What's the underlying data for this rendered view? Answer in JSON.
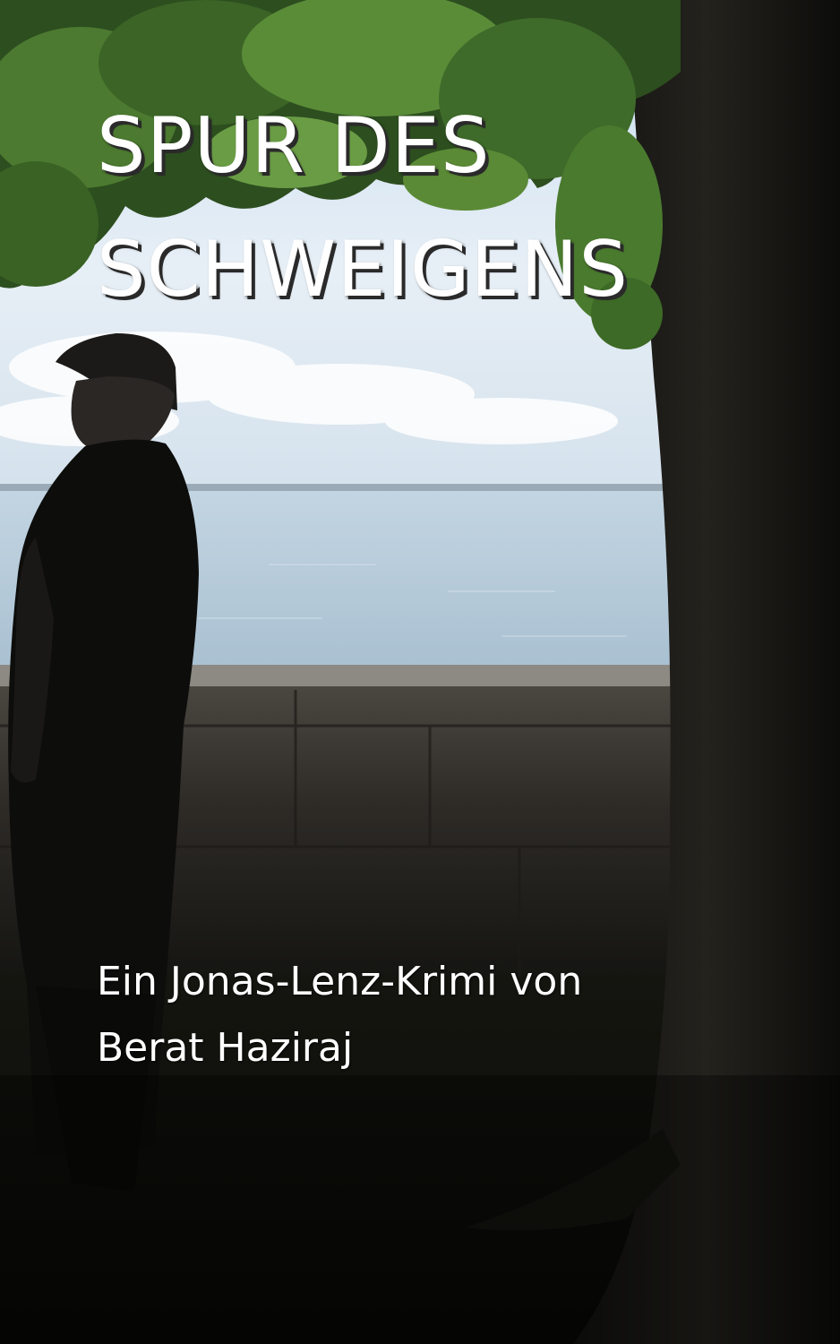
{
  "cover": {
    "title_line_1": "SPUR DES",
    "title_line_2": "SCHWEIGENS",
    "subtitle_line_1": "Ein Jonas-Lenz-Krimi von",
    "subtitle_line_2": "Berat Haziraj"
  },
  "colors": {
    "sky": "#dbe8f4",
    "water": "#b8cede",
    "foliage": "#3f6b2a",
    "trunk": "#1a1a16",
    "wall": "#3a3630",
    "ground": "#0f0f0c",
    "text": "#ffffff"
  }
}
